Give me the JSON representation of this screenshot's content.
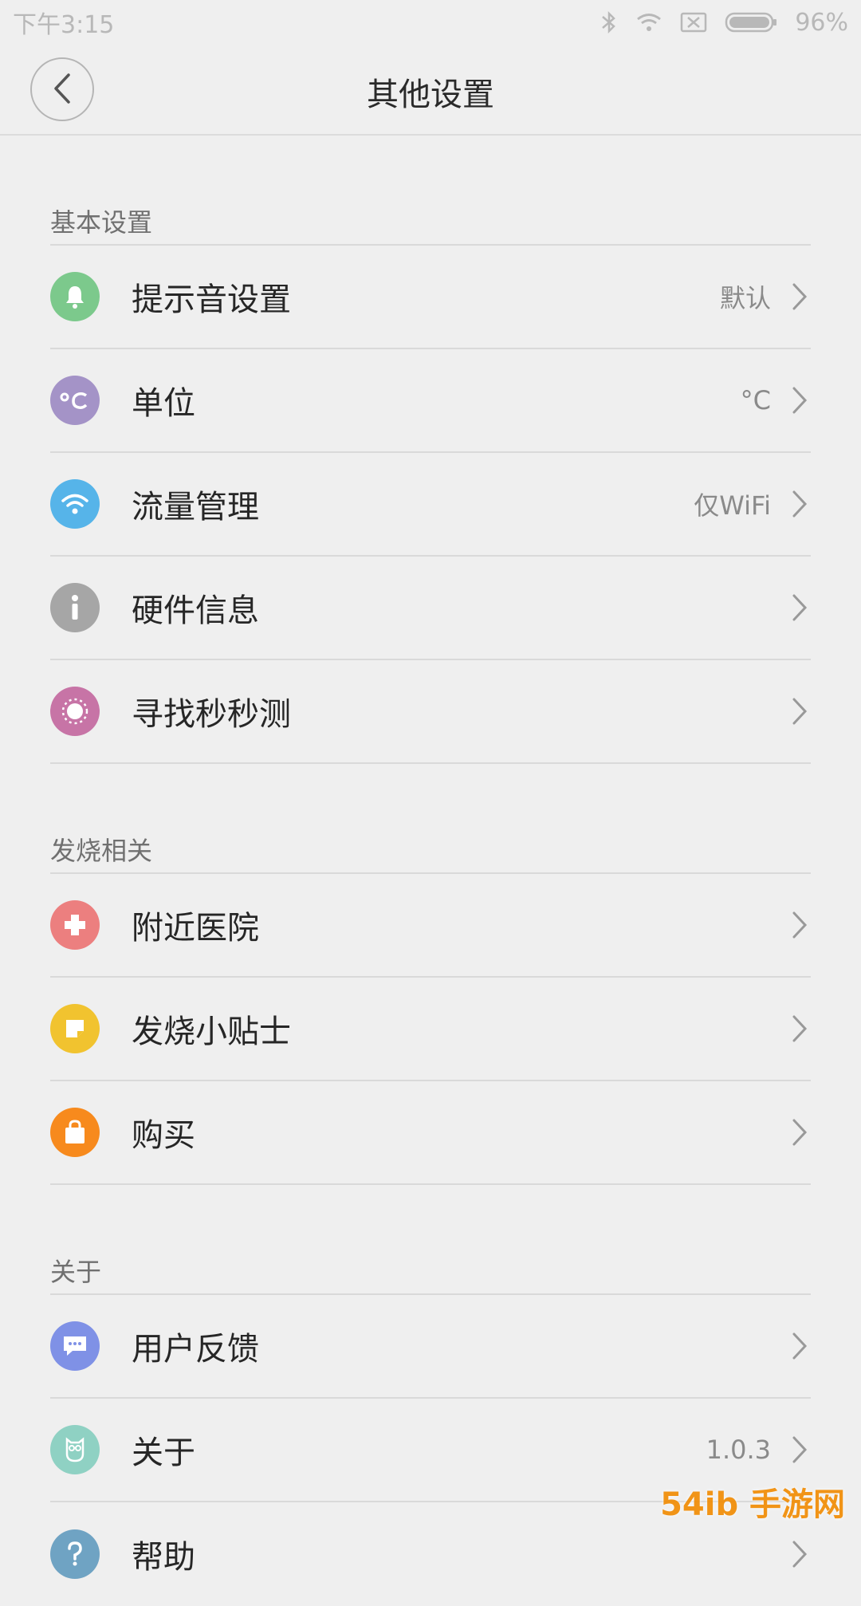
{
  "status_bar": {
    "time": "下午3:15",
    "battery": "96%"
  },
  "header": {
    "title": "其他设置"
  },
  "sections": [
    {
      "title": "基本设置",
      "items": [
        {
          "label": "提示音设置",
          "value": "默认",
          "icon": "bell-icon",
          "color": "#7cc98c"
        },
        {
          "label": "单位",
          "value": "°C",
          "icon": "celsius-icon",
          "color": "#a493c7"
        },
        {
          "label": "流量管理",
          "value": "仅WiFi",
          "icon": "wifi-icon",
          "color": "#56b4e9"
        },
        {
          "label": "硬件信息",
          "value": "",
          "icon": "info-icon",
          "color": "#a6a6a6"
        },
        {
          "label": "寻找秒秒测",
          "value": "",
          "icon": "find-device-icon",
          "color": "#c774a6"
        }
      ]
    },
    {
      "title": "发烧相关",
      "items": [
        {
          "label": "附近医院",
          "value": "",
          "icon": "hospital-cross-icon",
          "color": "#ec7f7f"
        },
        {
          "label": "发烧小贴士",
          "value": "",
          "icon": "sticky-note-icon",
          "color": "#f1c32f"
        },
        {
          "label": "购买",
          "value": "",
          "icon": "shopping-bag-icon",
          "color": "#f78a1d"
        }
      ]
    },
    {
      "title": "关于",
      "items": [
        {
          "label": "用户反馈",
          "value": "",
          "icon": "chat-bubble-icon",
          "color": "#7f91e6"
        },
        {
          "label": "关于",
          "value": "1.0.3",
          "icon": "owl-icon",
          "color": "#8fd1c3"
        },
        {
          "label": "帮助",
          "value": "",
          "icon": "help-icon",
          "color": "#6fa3c3"
        }
      ]
    }
  ],
  "watermark": "54ib 手游网"
}
